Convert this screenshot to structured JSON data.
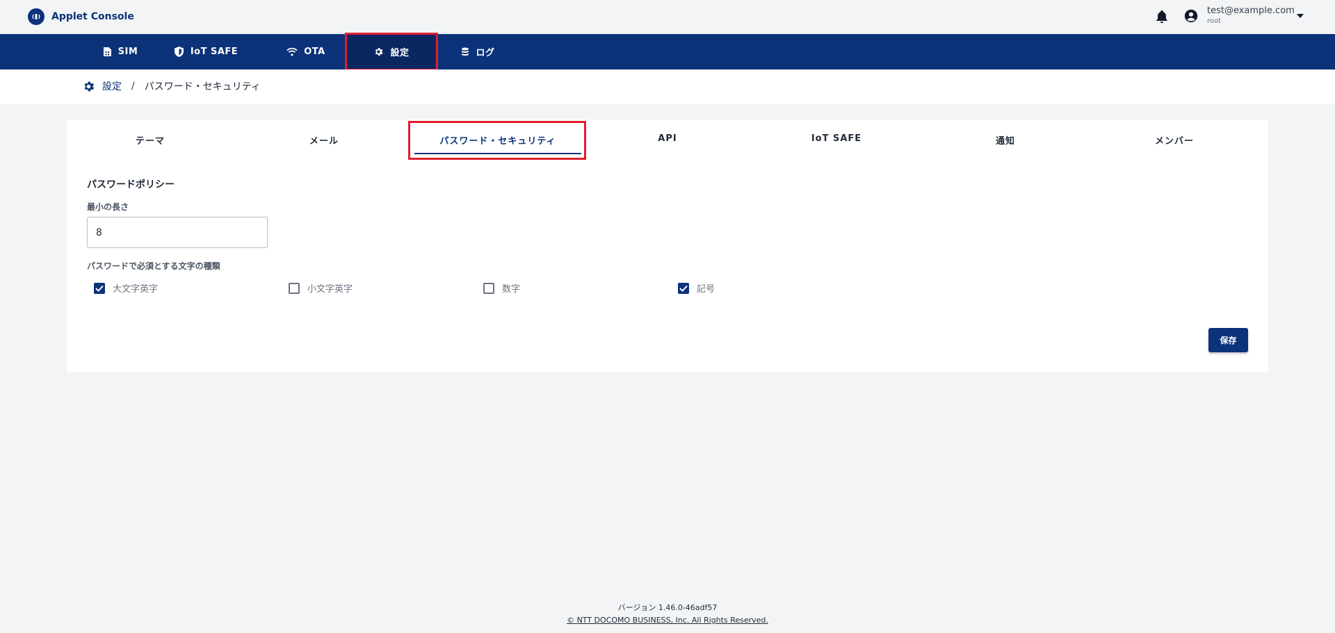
{
  "app": {
    "name": "Applet Console"
  },
  "account": {
    "email": "test@example.com",
    "role": "root"
  },
  "nav": {
    "items": [
      {
        "label": "SIM",
        "icon": "sim-card-icon"
      },
      {
        "label": "IoT SAFE",
        "icon": "shield-icon"
      },
      {
        "label": "OTA",
        "icon": "wifi-icon"
      },
      {
        "label": "設定",
        "icon": "gear-icon",
        "active": true
      },
      {
        "label": "ログ",
        "icon": "database-icon"
      }
    ]
  },
  "breadcrumb": {
    "root": "設定",
    "separator": "/",
    "current": "パスワード・セキュリティ"
  },
  "tabs": [
    {
      "label": "テーマ"
    },
    {
      "label": "メール"
    },
    {
      "label": "パスワード・セキュリティ",
      "active": true
    },
    {
      "label": "API"
    },
    {
      "label": "IoT SAFE"
    },
    {
      "label": "通知"
    },
    {
      "label": "メンバー"
    }
  ],
  "password_policy": {
    "title": "パスワードポリシー",
    "min_length_label": "最小の長さ",
    "min_length_value": "8",
    "required_chars_label": "パスワードで必須とする文字の種類",
    "options": [
      {
        "label": "大文字英字",
        "checked": true
      },
      {
        "label": "小文字英字",
        "checked": false
      },
      {
        "label": "数字",
        "checked": false
      },
      {
        "label": "記号",
        "checked": true
      }
    ]
  },
  "actions": {
    "save_label": "保存"
  },
  "footer": {
    "version": "バージョン 1.46.0-46adf57",
    "copyright": "© NTT DOCOMO BUSINESS, Inc. All Rights Reserved."
  },
  "colors": {
    "brand": "#0c3279",
    "highlight": "#e11d2e",
    "background": "#f3f4f6"
  }
}
